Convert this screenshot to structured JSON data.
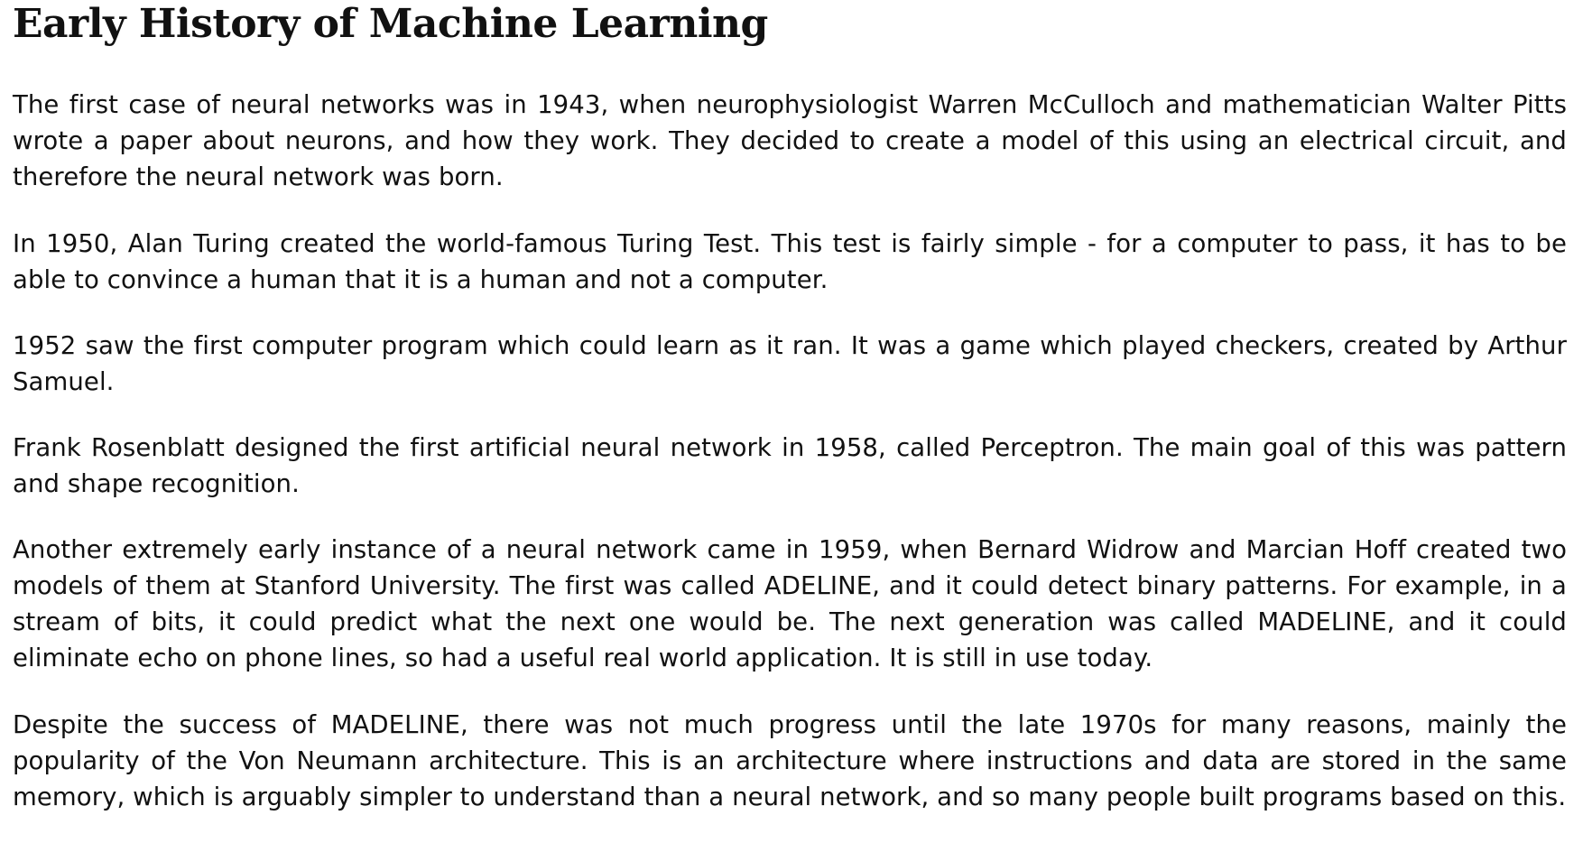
{
  "article": {
    "title": "Early History of Machine Learning",
    "paragraphs": [
      "The first case of neural networks was in 1943, when neurophysiologist Warren McCulloch and mathematician Walter Pitts wrote a paper about neurons, and how they work. They decided to create a model of this using an electrical circuit, and therefore the neural network was born.",
      "In 1950, Alan Turing created the world-famous Turing Test. This test is fairly simple - for a computer to pass, it has to be able to convince a human that it is a human and not a computer.",
      "1952 saw the first computer program which could learn as it ran. It was a game which played checkers, created by Arthur Samuel.",
      "Frank Rosenblatt designed the first artificial neural network in 1958, called Perceptron. The main goal of this was pattern and shape recognition.",
      "Another extremely early instance of a neural network came in 1959, when Bernard Widrow and Marcian Hoff created two models of them at Stanford University. The first was called ADELINE, and it could detect binary patterns. For example, in a stream of bits, it could predict what the next one would be. The next generation was called MADELINE, and it could eliminate echo on phone lines, so had a useful real world application. It is still in use today.",
      "Despite the success of MADELINE, there was not much progress until the late 1970s for many reasons, mainly the popularity of the Von Neumann architecture. This is an architecture where instructions and data are stored in the same memory, which is arguably simpler to understand than a neural network, and so many people built programs based on this."
    ]
  }
}
